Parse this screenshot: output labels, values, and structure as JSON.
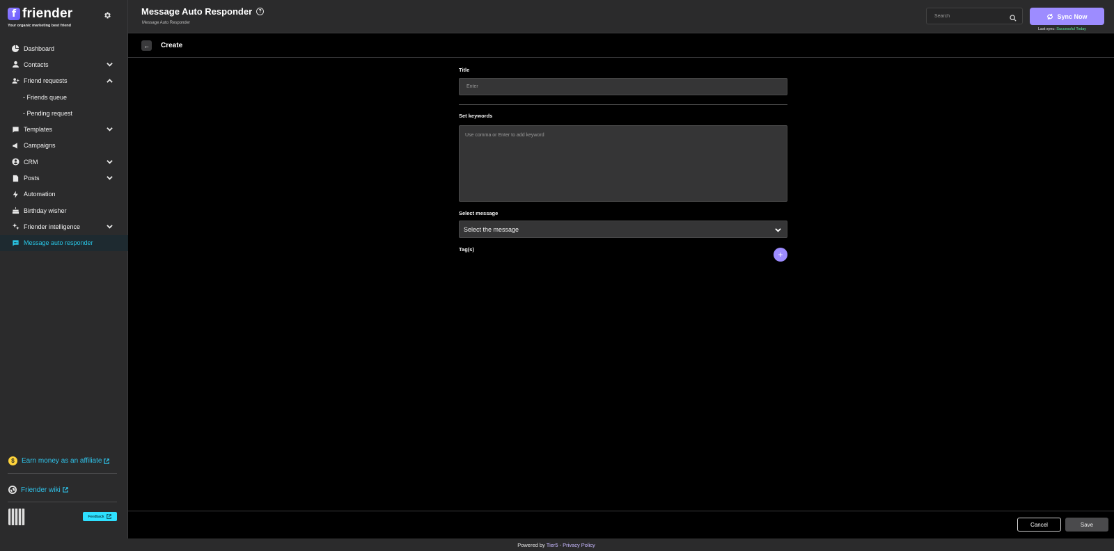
{
  "brand": {
    "name": "friender",
    "tagline": "Your organic marketing best friend",
    "logo_letter": "f"
  },
  "header": {
    "title": "Message Auto Responder",
    "breadcrumb": "Message Auto Responder",
    "search_placeholder": "Search",
    "sync_label": "Sync Now",
    "last_sync_prefix": "Last sync:",
    "last_sync_status": "Successful Today"
  },
  "sidebar": {
    "items": [
      {
        "label": "Dashboard",
        "icon": "dashboard-icon"
      },
      {
        "label": "Contacts",
        "icon": "contacts-icon",
        "has_chevron": true
      },
      {
        "label": "Friend requests",
        "icon": "friend-requests-icon",
        "has_chevron": true,
        "expanded": true
      },
      {
        "label": "- Friends queue",
        "sub": true
      },
      {
        "label": "- Pending request",
        "sub": true
      },
      {
        "label": "Templates",
        "icon": "templates-icon",
        "has_chevron": true
      },
      {
        "label": "Campaigns",
        "icon": "campaigns-icon"
      },
      {
        "label": "CRM",
        "icon": "crm-icon",
        "has_chevron": true
      },
      {
        "label": "Posts",
        "icon": "posts-icon",
        "has_chevron": true
      },
      {
        "label": "Automation",
        "icon": "automation-icon"
      },
      {
        "label": "Birthday wisher",
        "icon": "birthday-icon"
      },
      {
        "label": "Friender intelligence",
        "icon": "intelligence-icon",
        "has_chevron": true
      },
      {
        "label": "Message auto responder",
        "icon": "auto-responder-icon",
        "active": true
      }
    ],
    "affiliate_label": "Earn money as an affiliate",
    "coin_symbol": "$",
    "wiki_label": "Friender wiki",
    "feedback_label": "Feedback"
  },
  "subbar": {
    "title": "Create",
    "back_symbol": "←"
  },
  "form": {
    "title_label": "Title",
    "title_placeholder": "Enter",
    "keywords_label": "Set keywords",
    "keywords_placeholder": "Use comma or Enter to add keyword",
    "message_label": "Select message",
    "message_value": "Select the message",
    "tags_label": "Tag(s)",
    "add_symbol": "+"
  },
  "footer": {
    "cancel_label": "Cancel",
    "save_label": "Save",
    "powered_prefix": "Powered by",
    "powered_brand": "Tier5",
    "powered_sep": "-",
    "privacy_label": "Privacy Policy"
  },
  "colors": {
    "accent": "#9d8cff",
    "active_link": "#29c6e6",
    "sidebar_bg": "#2b2b2c",
    "success": "#5fe89b"
  }
}
